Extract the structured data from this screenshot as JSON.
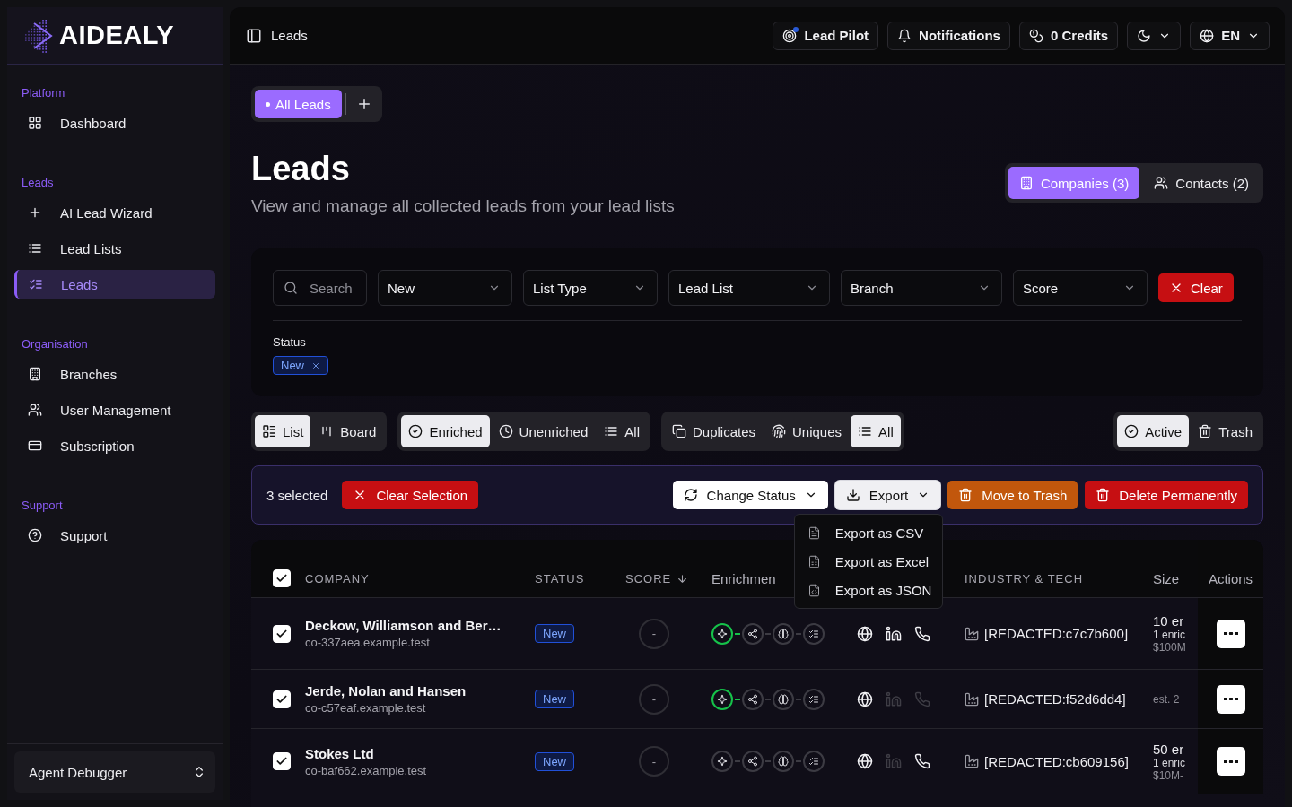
{
  "sidebar": {
    "logo": "AIDEALY",
    "sections": [
      {
        "title": "Platform",
        "items": [
          {
            "label": "Dashboard",
            "selected": false
          }
        ]
      },
      {
        "title": "Leads",
        "items": [
          {
            "label": "AI Lead Wizard",
            "selected": false
          },
          {
            "label": "Lead Lists",
            "selected": false
          },
          {
            "label": "Leads",
            "selected": true
          }
        ]
      },
      {
        "title": "Organisation",
        "items": [
          {
            "label": "Branches",
            "selected": false
          },
          {
            "label": "User Management",
            "selected": false
          },
          {
            "label": "Subscription",
            "selected": false
          }
        ]
      },
      {
        "title": "Support",
        "items": [
          {
            "label": "Support",
            "selected": false
          }
        ]
      }
    ],
    "footer": {
      "label": "Agent Debugger"
    }
  },
  "topbar": {
    "breadcrumb": "Leads",
    "lead_pilot": {
      "label": "Lead Pilot",
      "dot": true
    },
    "notifications": {
      "label": "Notifications"
    },
    "credits": {
      "label": "0 Credits"
    },
    "language": {
      "label": "EN"
    }
  },
  "view_tabs": [
    {
      "label": "All Leads",
      "selected": true
    }
  ],
  "header": {
    "title": "Leads",
    "subtitle": "View and manage all collected leads from your lead lists",
    "entity_tabs": [
      {
        "label": "Companies (3)",
        "selected": true
      },
      {
        "label": "Contacts (2)",
        "selected": false
      }
    ]
  },
  "filters": {
    "search": {
      "placeholder": "Search"
    },
    "selects": [
      {
        "label": "New"
      },
      {
        "label": "List Type"
      },
      {
        "label": "Lead List"
      },
      {
        "label": "Branch"
      },
      {
        "label": "Score"
      }
    ],
    "clear": "Clear",
    "status_label": "Status",
    "status_chips": [
      "New"
    ]
  },
  "segments": [
    {
      "items": [
        {
          "label": "List",
          "selected": true
        },
        {
          "label": "Board",
          "selected": false
        }
      ]
    },
    {
      "items": [
        {
          "label": "Enriched",
          "selected": true
        },
        {
          "label": "Unenriched",
          "selected": false
        },
        {
          "label": "All",
          "selected": false
        }
      ]
    },
    {
      "items": [
        {
          "label": "Duplicates",
          "selected": false
        },
        {
          "label": "Uniques",
          "selected": false
        },
        {
          "label": "All",
          "selected": true
        }
      ]
    },
    {
      "items": [
        {
          "label": "Active",
          "selected": true
        },
        {
          "label": "Trash",
          "selected": false
        }
      ]
    }
  ],
  "bulk_bar": {
    "count": "3 selected",
    "clear_selection": "Clear Selection",
    "change_status": "Change Status",
    "export": {
      "label": "Export",
      "expanded": true,
      "menu": [
        "Export as CSV",
        "Export as Excel",
        "Export as JSON"
      ]
    },
    "move_to_trash": "Move to Trash",
    "delete": "Delete Permanently"
  },
  "table": {
    "all_selected": true,
    "columns": {
      "company": "COMPANY",
      "status": "STATUS",
      "score": {
        "label": "SCORE",
        "sorted": true
      },
      "enrichment": "Enrichmen",
      "industry": "INDUSTRY & TECH",
      "size": "Size",
      "actions": "Actions"
    },
    "rows": [
      {
        "selected": true,
        "name": "Deckow, Williamson and Ber…",
        "domain": "co-337aea.example.test",
        "status": "New",
        "score": "-",
        "enrichment": [
          {
            "done": true
          },
          {
            "done": false
          },
          {
            "done": false
          },
          {
            "done": false
          }
        ],
        "links": [
          {
            "available": true
          },
          {
            "available": true
          },
          {
            "available": true
          }
        ],
        "industry": "[REDACTED:c7c7b600]",
        "size": [
          "10 er",
          "1 enric",
          "$100M"
        ]
      },
      {
        "selected": true,
        "name": "Jerde, Nolan and Hansen",
        "domain": "co-c57eaf.example.test",
        "status": "New",
        "score": "-",
        "enrichment": [
          {
            "done": true
          },
          {
            "done": false
          },
          {
            "done": false
          },
          {
            "done": false
          }
        ],
        "links": [
          {
            "available": true
          },
          {
            "available": false
          },
          {
            "available": false
          }
        ],
        "industry": "[REDACTED:f52d6dd4]",
        "size": [
          "est. 2"
        ]
      },
      {
        "selected": true,
        "name": "Stokes Ltd",
        "domain": "co-baf662.example.test",
        "status": "New",
        "score": "-",
        "enrichment": [
          {
            "done": false
          },
          {
            "done": false
          },
          {
            "done": false
          },
          {
            "done": false
          }
        ],
        "links": [
          {
            "available": true
          },
          {
            "available": false
          },
          {
            "available": true
          }
        ],
        "industry": "[REDACTED:cb609156]",
        "size": [
          "50 er",
          "1 enric",
          "$10M-"
        ]
      }
    ]
  }
}
